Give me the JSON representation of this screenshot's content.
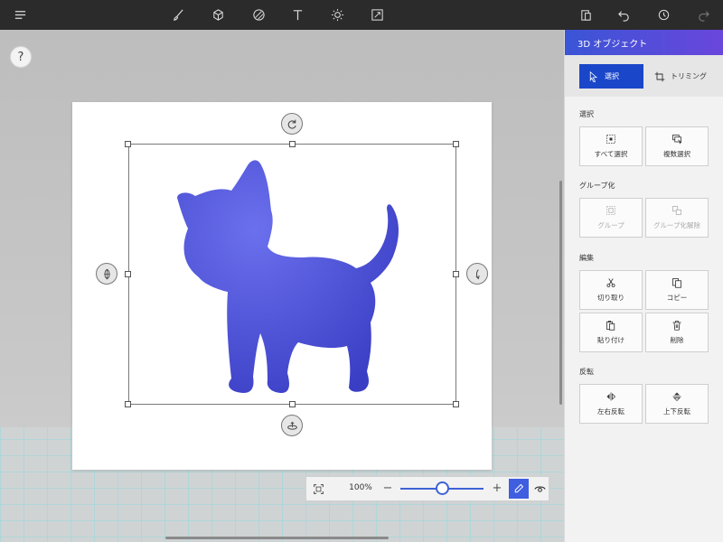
{
  "toolbar": {
    "menu_icon": "hamburger-icon",
    "tools": [
      "brush-icon",
      "cube-icon",
      "sticker-icon",
      "text-icon",
      "effects-icon",
      "canvas-icon"
    ],
    "right": [
      "paste-icon",
      "undo-icon",
      "history-icon",
      "redo-icon"
    ]
  },
  "canvas": {
    "help_label": "?"
  },
  "zoom": {
    "percent": "100%",
    "minus": "−",
    "plus": "+",
    "level": 0.5
  },
  "panel": {
    "title": "3D オブジェクト",
    "modes": {
      "select": "選択",
      "trim": "トリミング"
    },
    "sections": {
      "select": {
        "label": "選択",
        "select_all": "すべて選択",
        "multi_select": "複数選択"
      },
      "group": {
        "label": "グループ化",
        "group": "グループ",
        "ungroup": "グループ化解除"
      },
      "edit": {
        "label": "編集",
        "cut": "切り取り",
        "copy": "コピー",
        "paste": "貼り付け",
        "delete": "削除"
      },
      "flip": {
        "label": "反転",
        "horizontal": "左右反転",
        "vertical": "上下反転"
      }
    }
  },
  "colors": {
    "accent": "#3f5ee0",
    "active_mode": "#1a47c9",
    "model": "#4a4ed8",
    "toolbar": "#2b2b2b"
  }
}
